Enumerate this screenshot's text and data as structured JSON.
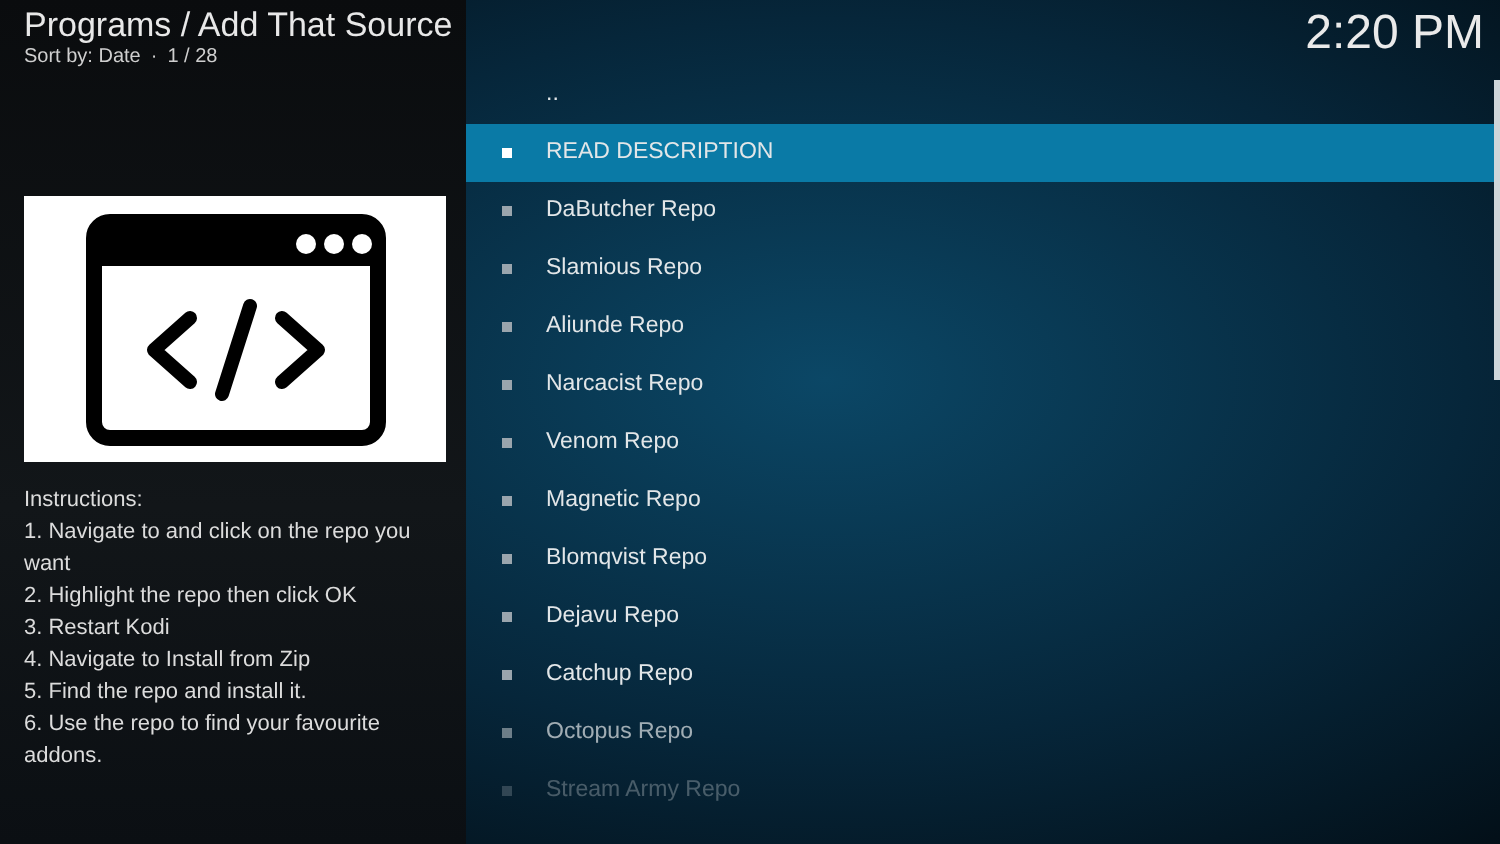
{
  "header": {
    "title": "Programs / Add That Source",
    "sort": "Sort by: Date",
    "separator": "·",
    "position": "1 / 28",
    "clock": "2:20 PM"
  },
  "info": {
    "instructions": [
      "Instructions:",
      "1. Navigate to and click on the repo you want",
      "2. Highlight the repo then click OK",
      "3. Restart Kodi",
      "4. Navigate to Install from Zip",
      "5. Find the repo and install it.",
      "6. Use the repo to find your favourite addons."
    ]
  },
  "list": [
    {
      "label": "..",
      "kind": "parent",
      "selected": false
    },
    {
      "label": "READ DESCRIPTION",
      "kind": "item",
      "selected": true
    },
    {
      "label": "DaButcher Repo",
      "kind": "item",
      "selected": false
    },
    {
      "label": "Slamious Repo",
      "kind": "item",
      "selected": false
    },
    {
      "label": "Aliunde Repo",
      "kind": "item",
      "selected": false
    },
    {
      "label": "Narcacist Repo",
      "kind": "item",
      "selected": false
    },
    {
      "label": "Venom Repo",
      "kind": "item",
      "selected": false
    },
    {
      "label": "Magnetic Repo",
      "kind": "item",
      "selected": false
    },
    {
      "label": "Blomqvist Repo",
      "kind": "item",
      "selected": false
    },
    {
      "label": "Dejavu Repo",
      "kind": "item",
      "selected": false
    },
    {
      "label": "Catchup Repo",
      "kind": "item",
      "selected": false
    },
    {
      "label": "Octopus Repo",
      "kind": "item",
      "selected": false
    },
    {
      "label": "Stream Army Repo",
      "kind": "item",
      "selected": false
    }
  ]
}
